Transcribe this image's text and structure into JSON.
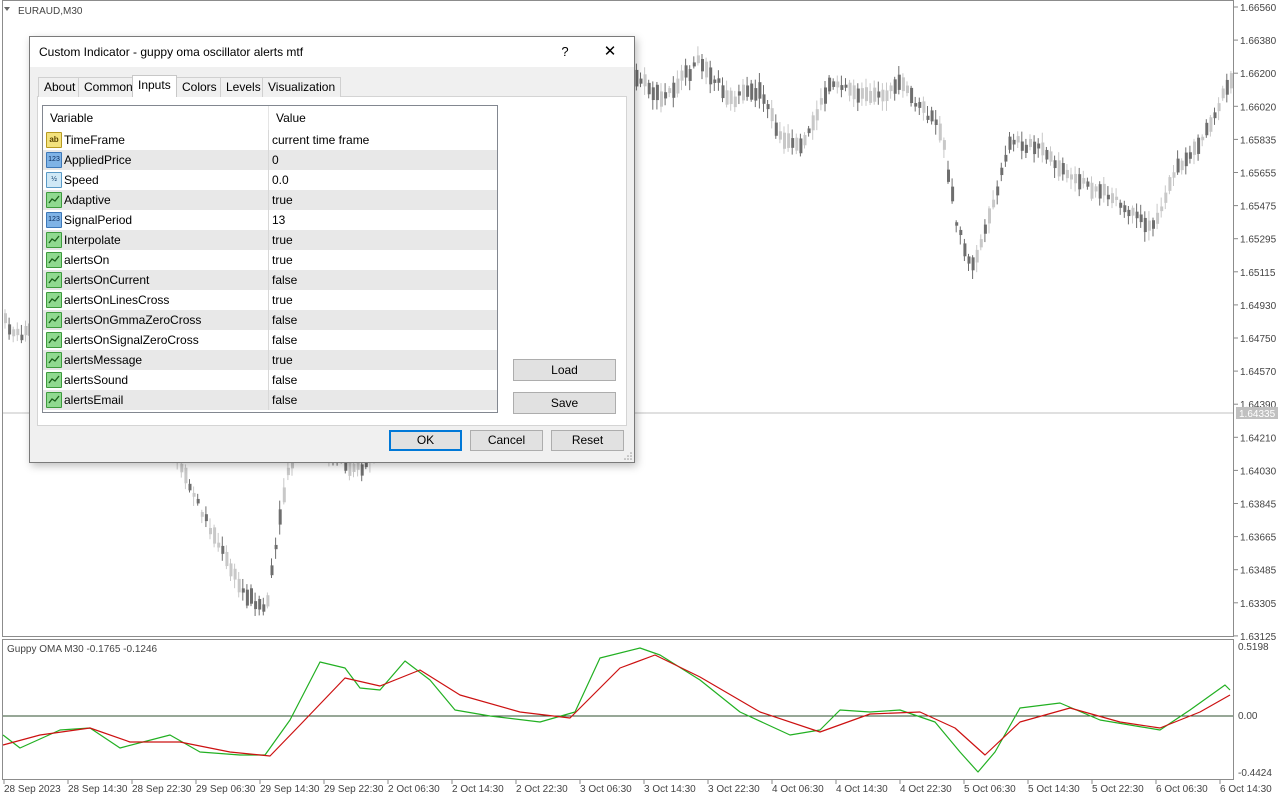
{
  "chart": {
    "symbol_label": "EURAUD,M30",
    "price_ticks": [
      "1.66560",
      "1.66380",
      "1.66200",
      "1.66020",
      "1.65835",
      "1.65655",
      "1.65475",
      "1.65295",
      "1.65115",
      "1.64930",
      "1.64750",
      "1.64570",
      "1.64390",
      "1.64210",
      "1.64030",
      "1.63845",
      "1.63665",
      "1.63485",
      "1.63305",
      "1.63125"
    ],
    "current_price": "1.64335",
    "time_ticks": [
      "28 Sep 2023",
      "28 Sep 14:30",
      "28 Sep 22:30",
      "29 Sep 06:30",
      "29 Sep 14:30",
      "29 Sep 22:30",
      "2 Oct 06:30",
      "2 Oct 14:30",
      "2 Oct 22:30",
      "3 Oct 06:30",
      "3 Oct 14:30",
      "3 Oct 22:30",
      "4 Oct 06:30",
      "4 Oct 14:30",
      "4 Oct 22:30",
      "5 Oct 06:30",
      "5 Oct 14:30",
      "5 Oct 22:30",
      "6 Oct 06:30",
      "6 Oct 14:30"
    ],
    "colors": {
      "bull_candle": "#c8c8c8",
      "bear_candle": "#6e6e6e",
      "price_line": "#c0c0c0",
      "frame": "#8c8c8c"
    }
  },
  "indicator": {
    "label": "Guppy OMA M30 -0.1765 -0.1246",
    "scale_top": "0.5198",
    "scale_zero": "0.00",
    "scale_bottom": "-0.4424",
    "colors": {
      "fast": "#22b022",
      "signal": "#cc1111",
      "zero_line": "#2f4f2f"
    }
  },
  "dialog": {
    "title": "Custom Indicator - guppy oma oscillator alerts mtf",
    "help_label": "?",
    "close_label": "✕",
    "tabs": [
      {
        "label": "About"
      },
      {
        "label": "Common"
      },
      {
        "label": "Inputs"
      },
      {
        "label": "Colors"
      },
      {
        "label": "Levels"
      },
      {
        "label": "Visualization"
      }
    ],
    "active_tab": "Inputs",
    "grid": {
      "col_variable": "Variable",
      "col_value": "Value",
      "rows": [
        {
          "icon": "ab",
          "name": "TimeFrame",
          "value": "current time frame"
        },
        {
          "icon": "num",
          "name": "AppliedPrice",
          "value": "0"
        },
        {
          "icon": "dbl",
          "name": "Speed",
          "value": "0.0"
        },
        {
          "icon": "bool",
          "name": "Adaptive",
          "value": "true"
        },
        {
          "icon": "num",
          "name": "SignalPeriod",
          "value": "13"
        },
        {
          "icon": "bool",
          "name": "Interpolate",
          "value": "true"
        },
        {
          "icon": "bool",
          "name": "alertsOn",
          "value": "true"
        },
        {
          "icon": "bool",
          "name": "alertsOnCurrent",
          "value": "false"
        },
        {
          "icon": "bool",
          "name": "alertsOnLinesCross",
          "value": "true"
        },
        {
          "icon": "bool",
          "name": "alertsOnGmmaZeroCross",
          "value": "false"
        },
        {
          "icon": "bool",
          "name": "alertsOnSignalZeroCross",
          "value": "false"
        },
        {
          "icon": "bool",
          "name": "alertsMessage",
          "value": "true"
        },
        {
          "icon": "bool",
          "name": "alertsSound",
          "value": "false"
        },
        {
          "icon": "bool",
          "name": "alertsEmail",
          "value": "false"
        }
      ]
    },
    "icon_glyphs": {
      "ab": "ab",
      "num": "123",
      "dbl": "½"
    },
    "buttons": {
      "load": "Load",
      "save": "Save",
      "ok": "OK",
      "cancel": "Cancel",
      "reset": "Reset"
    }
  }
}
